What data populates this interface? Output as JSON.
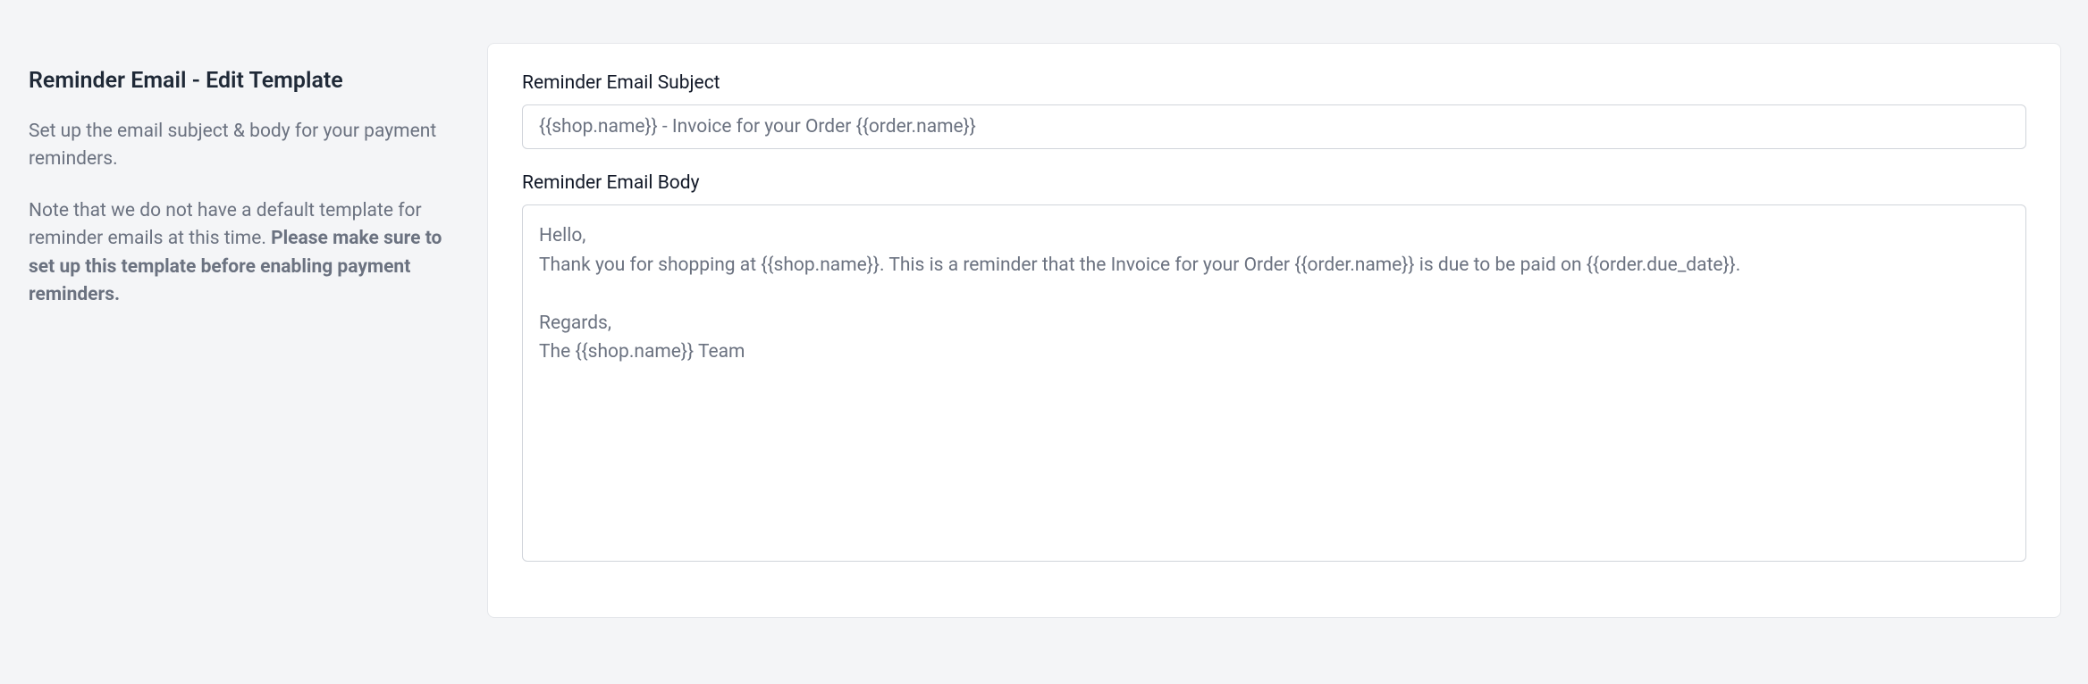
{
  "left": {
    "title": "Reminder Email - Edit Template",
    "description": "Set up the email subject & body for your payment reminders.",
    "note_prefix": "Note that we do not have a default template for reminder emails at this time. ",
    "note_bold": "Please make sure to set up this template before enabling payment reminders."
  },
  "form": {
    "subject_label": "Reminder Email Subject",
    "subject_placeholder": "{{shop.name}} - Invoice for your Order {{order.name}}",
    "body_label": "Reminder Email Body",
    "body_placeholder": "Hello,\nThank you for shopping at {{shop.name}}. This is a reminder that the Invoice for your Order {{order.name}} is due to be paid on {{order.due_date}}.\n\nRegards,\nThe {{shop.name}} Team"
  }
}
